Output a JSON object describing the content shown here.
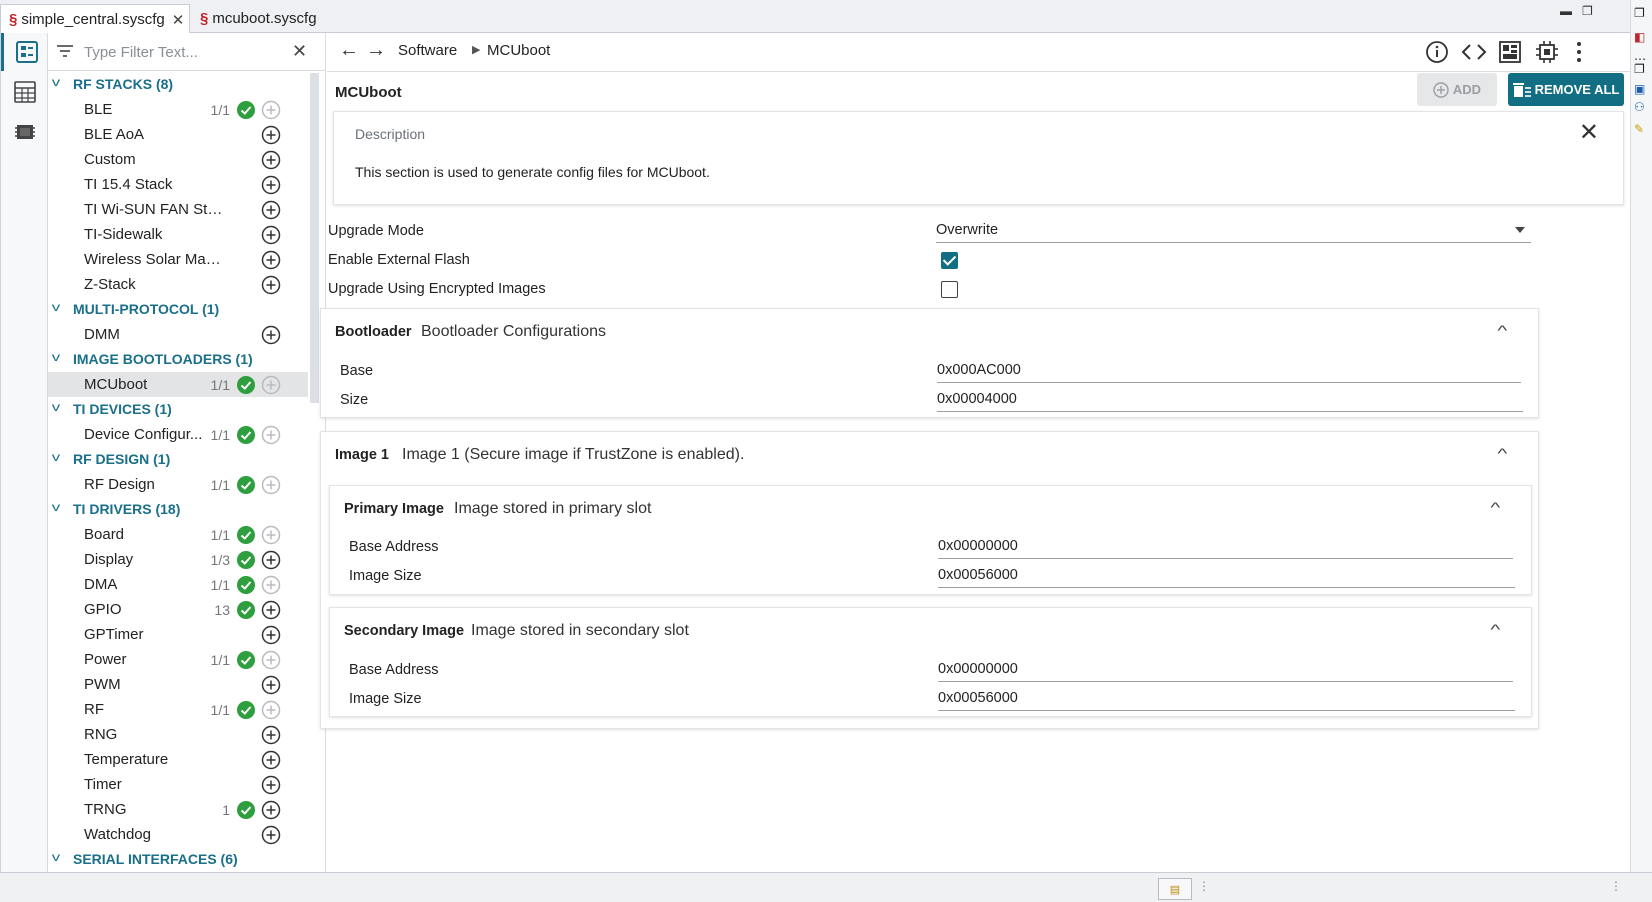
{
  "tabs": [
    {
      "name": "simple_central.syscfg",
      "active": true
    },
    {
      "name": "mcuboot.syscfg",
      "active": false
    }
  ],
  "filter": {
    "placeholder": "Type Filter Text..."
  },
  "tree": {
    "categories": [
      {
        "label": "RF STACKS (8)",
        "items": [
          {
            "label": "BLE",
            "count": "1/1",
            "ok": true,
            "add_enabled": false
          },
          {
            "label": "BLE AoA",
            "count": "",
            "ok": false,
            "add_enabled": true
          },
          {
            "label": "Custom",
            "count": "",
            "ok": false,
            "add_enabled": true
          },
          {
            "label": "TI 15.4 Stack",
            "count": "",
            "ok": false,
            "add_enabled": true
          },
          {
            "label": "TI Wi-SUN FAN Stack",
            "count": "",
            "ok": false,
            "add_enabled": true
          },
          {
            "label": "TI-Sidewalk",
            "count": "",
            "ok": false,
            "add_enabled": true
          },
          {
            "label": "Wireless Solar Managem...",
            "count": "",
            "ok": false,
            "add_enabled": true
          },
          {
            "label": "Z-Stack",
            "count": "",
            "ok": false,
            "add_enabled": true
          }
        ]
      },
      {
        "label": "MULTI-PROTOCOL (1)",
        "items": [
          {
            "label": "DMM",
            "count": "",
            "ok": false,
            "add_enabled": true
          }
        ]
      },
      {
        "label": "IMAGE BOOTLOADERS (1)",
        "items": [
          {
            "label": "MCUboot",
            "count": "1/1",
            "ok": true,
            "add_enabled": false,
            "selected": true
          }
        ]
      },
      {
        "label": "TI DEVICES (1)",
        "items": [
          {
            "label": "Device Configur...",
            "count": "1/1",
            "ok": true,
            "add_enabled": false
          }
        ]
      },
      {
        "label": "RF DESIGN (1)",
        "items": [
          {
            "label": "RF Design",
            "count": "1/1",
            "ok": true,
            "add_enabled": false
          }
        ]
      },
      {
        "label": "TI DRIVERS (18)",
        "items": [
          {
            "label": "Board",
            "count": "1/1",
            "ok": true,
            "add_enabled": false
          },
          {
            "label": "Display",
            "count": "1/3",
            "ok": true,
            "add_enabled": true
          },
          {
            "label": "DMA",
            "count": "1/1",
            "ok": true,
            "add_enabled": false
          },
          {
            "label": "GPIO",
            "count": "13",
            "ok": true,
            "add_enabled": true
          },
          {
            "label": "GPTimer",
            "count": "",
            "ok": false,
            "add_enabled": true
          },
          {
            "label": "Power",
            "count": "1/1",
            "ok": true,
            "add_enabled": false
          },
          {
            "label": "PWM",
            "count": "",
            "ok": false,
            "add_enabled": true
          },
          {
            "label": "RF",
            "count": "1/1",
            "ok": true,
            "add_enabled": false
          },
          {
            "label": "RNG",
            "count": "",
            "ok": false,
            "add_enabled": true
          },
          {
            "label": "Temperature",
            "count": "",
            "ok": false,
            "add_enabled": true
          },
          {
            "label": "Timer",
            "count": "",
            "ok": false,
            "add_enabled": true
          },
          {
            "label": "TRNG",
            "count": "1",
            "ok": true,
            "add_enabled": true
          },
          {
            "label": "Watchdog",
            "count": "",
            "ok": false,
            "add_enabled": true
          }
        ]
      },
      {
        "label": "SERIAL INTERFACES (6)",
        "items": []
      }
    ]
  },
  "breadcrumb": {
    "root": "Software",
    "current": "MCUboot"
  },
  "module": {
    "title": "MCUboot",
    "add_label": "ADD",
    "remove_all_label": "REMOVE ALL",
    "description_title": "Description",
    "description_text": "This section is used to generate config files for MCUboot."
  },
  "config": {
    "upgrade_mode_label": "Upgrade Mode",
    "upgrade_mode_value": "Overwrite",
    "external_flash_label": "Enable External Flash",
    "external_flash_checked": true,
    "encrypted_label": "Upgrade Using Encrypted Images",
    "encrypted_checked": false
  },
  "bootloader": {
    "name": "Bootloader",
    "desc": "Bootloader Configurations",
    "base_label": "Base",
    "base_value": "0x000AC000",
    "size_label": "Size",
    "size_value": "0x00004000"
  },
  "image1": {
    "name": "Image 1",
    "desc": "Image 1 (Secure image if TrustZone is enabled).",
    "primary": {
      "name": "Primary Image",
      "desc": "Image stored in primary slot",
      "base_label": "Base Address",
      "base_value": "0x00000000",
      "size_label": "Image Size",
      "size_value": "0x00056000"
    },
    "secondary": {
      "name": "Secondary Image",
      "desc": "Image stored in secondary slot",
      "base_label": "Base Address",
      "base_value": "0x00000000",
      "size_label": "Image Size",
      "size_value": "0x00056000"
    }
  },
  "colors": {
    "accent": "#126e82",
    "category": "#1a6f8a",
    "ok_green": "#2e9e3e",
    "file_icon": "#c0252b"
  },
  "icons": [
    "syscfg-file-icon",
    "close-icon",
    "filter-icon",
    "check-circle-icon",
    "add-circle-icon",
    "arrow-left-icon",
    "arrow-right-icon",
    "info-icon",
    "code-icon",
    "board-view-icon",
    "chip-icon",
    "more-vertical-icon",
    "trash-icon"
  ]
}
